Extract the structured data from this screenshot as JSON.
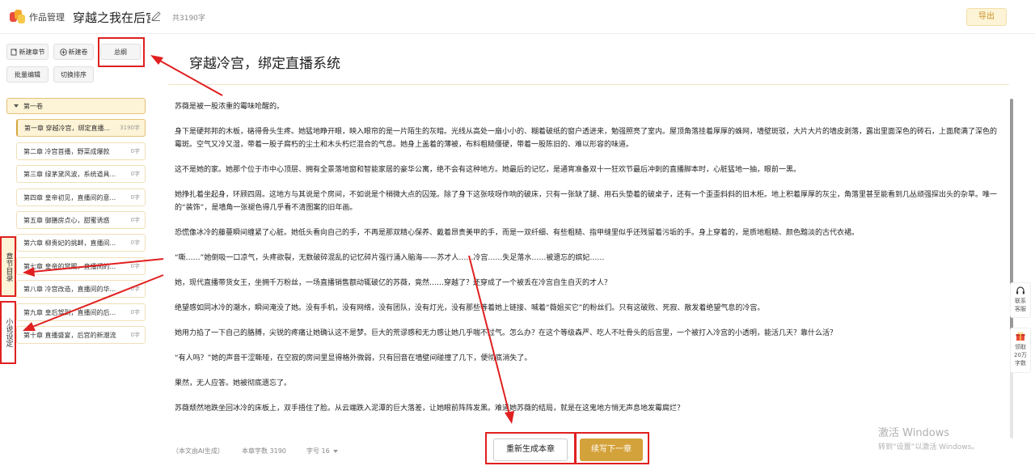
{
  "header": {
    "brand": "作品管理",
    "book_title": "穿越之我在后宫直播",
    "word_total": "共3190字",
    "export_label": "导出"
  },
  "sidebar": {
    "new_chapter": "新建章节",
    "new_volume": "新建卷",
    "outline": "总纲",
    "batch_edit": "批量编辑",
    "switch_sort": "切换排序",
    "volume_label": "第一卷",
    "chapters": [
      {
        "title": "第一章 穿越冷宫，绑定直播...",
        "count": "3190字"
      },
      {
        "title": "第二章 冷宫首播，野菜成爆款",
        "count": "0字"
      },
      {
        "title": "第三章 绿茅黛风波，系统道具...",
        "count": "0字"
      },
      {
        "title": "第四章 皇帝初见，直播间的意...",
        "count": "0字"
      },
      {
        "title": "第五章 御膳房点心，甜蜜诱惑",
        "count": "0字"
      },
      {
        "title": "第六章 柳贵妃的挑衅，直播间...",
        "count": "0字"
      },
      {
        "title": "第七章 皇帝的赏赐，直播间的...",
        "count": "0字"
      },
      {
        "title": "第八章 冷宫改造，直播间的华...",
        "count": "0字"
      },
      {
        "title": "第九章 皇后驾到，直播间的后...",
        "count": "0字"
      },
      {
        "title": "第十章 直播盛宴，后宫的新潮流",
        "count": "0字"
      }
    ]
  },
  "left_tabs": {
    "chapter_list": "章节目录",
    "novel_settings": "小说设定"
  },
  "main": {
    "chapter_title": "穿越冷宫，绑定直播系统",
    "paragraphs": [
      "苏薇是被一股浓重的霉味呛醒的。",
      "身下是硬邦邦的木板，硌得骨头生疼。她猛地睁开眼，映入眼帘的是一片陌生的灰暗。光线从高处一扇小小的、糊着破纸的窗户透进来，勉强照亮了室内。屋顶角落挂着厚厚的蛛网，墙壁斑驳，大片大片的墙皮剥落，露出里面深色的砖石，上面爬满了深色的霉斑。空气又冷又湿，带着一股子腐朽的尘土和木头朽烂混合的气息。她身上盖着的薄被，布料粗糙僵硬，带着一股陈旧的、难以形容的味道。",
      "这不是她的家。她那个位于市中心顶层、拥有全景落地窗和智能家居的豪华公寓，绝不会有这种地方。她最后的记忆，是通宵准备双十一狂欢节最后冲刺的直播脚本时，心脏猛地一抽，眼前一黑。",
      "她挣扎着坐起身，环顾四周。这地方与其说是个房间，不如说是个稍微大点的囚笼。除了身下这张吱呀作响的破床，只有一张缺了腿、用石头垫着的破桌子，还有一个歪歪斜斜的旧木柜。地上积着厚厚的灰尘，角落里甚至能看到几丛顽强探出头的杂草。唯一的“装饰”，是墙角一张褪色得几乎看不清图案的旧年画。",
      "恐慌像冰冷的藤蔓瞬间缠紧了心脏。她低头看向自己的手，不再是那双精心保养、戴着昂贵美甲的手，而是一双纤细、有些粗糙、指甲缝里似乎还残留着污垢的手。身上穿着的，是质地粗糙、颜色黯淡的古代衣裙。",
      "“嘶……”她倒吸一口凉气，头疼欲裂，无数破碎混乱的记忆碎片强行涌入脑海——苏才人……冷宫……失足落水……被遗忘的嫔妃……",
      "她，现代直播带货女王，坐拥千万粉丝，一场直播销售额动辄破亿的苏薇，竟然……穿越了？还穿成了一个被丢在冷宫自生自灭的才人？",
      "绝望感如同冰冷的潮水，瞬间淹没了她。没有手机，没有网络，没有团队，没有灯光，没有那些等着她上链接、喊着“薇姐买它”的粉丝们。只有这破败、死寂、散发着绝望气息的冷宫。",
      "她用力掐了一下自己的胳膊，尖锐的疼痛让她确认这不是梦。巨大的荒谬感和无力感让她几乎喘不过气。怎么办？在这个等级森严、吃人不吐骨头的后宫里，一个被打入冷宫的小透明，能活几天？靠什么活？",
      "“有人吗？”她的声音干涩嘶哑，在空寂的房间里显得格外微弱，只有回音在墙壁间碰撞了几下，便彻底消失了。",
      "果然，无人应答。她被彻底遗忘了。",
      "苏薇颓然地跌坐回冰冷的床板上，双手捂住了脸。从云端跌入泥潭的巨大落差，让她眼前阵阵发黑。难道她苏薇的结局，就是在这鬼地方悄无声息地发霉腐烂？"
    ]
  },
  "footer": {
    "ai_note": "（本文由AI生成）",
    "chapter_words": "本章字数 3190",
    "font_size": "字号 16",
    "regenerate": "重新生成本章",
    "continue": "续写下一章"
  },
  "right_widgets": {
    "support": "联系客服",
    "gift": "领取20万字数"
  },
  "watermark": {
    "line1": "激活 Windows",
    "line2": "转到“设置”以激活 Windows。"
  },
  "colors": {
    "accent": "#d4a23a",
    "accent_light": "#fdf3d6",
    "annotation_red": "#e02020"
  }
}
